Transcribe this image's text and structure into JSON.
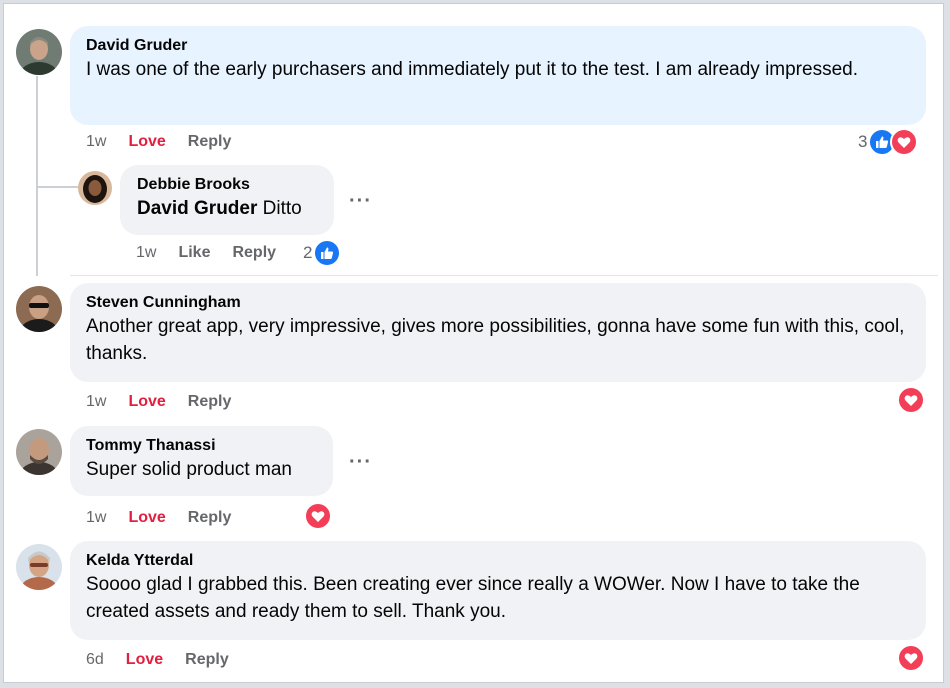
{
  "comments": [
    {
      "author": "David Gruder",
      "text": "I was one of the early purchasers and immediately put it to the test. I am already impressed.",
      "time": "1w",
      "love": "Love",
      "reply": "Reply",
      "reaction_count": "3",
      "reactions": [
        "like-icon",
        "love-icon"
      ],
      "avatar_colors": {
        "bg": "#6f7b73",
        "skin": "#c9a48a",
        "shirt": "#2d3a2f"
      },
      "reply_thread": {
        "author": "Debbie Brooks",
        "mention": "David Gruder",
        "text": "Ditto",
        "time": "1w",
        "like": "Like",
        "reply": "Reply",
        "reaction_count": "2",
        "reactions": [
          "like-icon"
        ],
        "more": "···",
        "avatar_colors": {
          "bg": "#d8b79a",
          "skin": "#8a5a3c",
          "hair": "#1e140f"
        }
      }
    },
    {
      "author": "Steven Cunningham",
      "text": "Another great app, very impressive, gives more possibilities, gonna have some fun with this, cool, thanks.",
      "time": "1w",
      "love": "Love",
      "reply": "Reply",
      "reactions": [
        "love-icon"
      ],
      "avatar_colors": {
        "bg": "#8c6b52",
        "skin": "#caa084",
        "shirt": "#1b1b1b"
      }
    },
    {
      "author": "Tommy Thanassi",
      "text": "Super solid product man",
      "time": "1w",
      "love": "Love",
      "reply": "Reply",
      "reactions": [
        "love-icon"
      ],
      "more": "···",
      "avatar_colors": {
        "bg": "#a9a39c",
        "skin": "#c49a7f",
        "shirt": "#3b3430"
      }
    },
    {
      "author": "Kelda Ytterdal",
      "text": "Soooo glad I grabbed this. Been creating ever since really a WOWer. Now I have to take the created assets and ready them to sell. Thank you.",
      "time": "6d",
      "love": "Love",
      "reply": "Reply",
      "reactions": [
        "love-icon"
      ],
      "avatar_colors": {
        "bg": "#d9e2ea",
        "skin": "#d4a585",
        "shirt": "#b46a4a"
      }
    }
  ],
  "colors": {
    "highlight_bubble": "#e7f3ff",
    "bubble": "#f0f2f5",
    "love_red": "#e41e3f",
    "like_blue": "#1877f2",
    "meta_gray": "#65676b"
  }
}
